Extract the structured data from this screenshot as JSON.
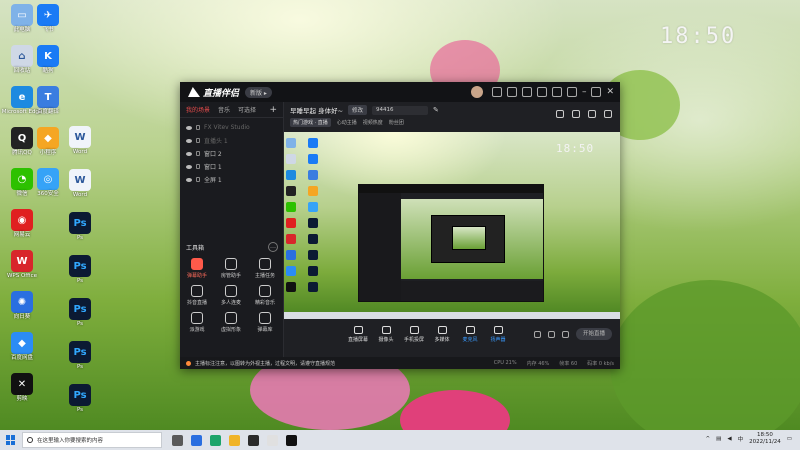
{
  "desktop": {
    "clock": "18:50",
    "icons_left": [
      {
        "label": "此电脑",
        "color": "#7fb2e8",
        "glyph": "▭"
      },
      {
        "label": "回收站",
        "color": "#cfd8e6",
        "glyph": "⌂"
      },
      {
        "label": "Microsoft Edge",
        "color": "#1d8ae0",
        "glyph": "e"
      },
      {
        "label": "腾讯QQ",
        "color": "#222222",
        "glyph": "Q"
      },
      {
        "label": "微信",
        "color": "#2dc100",
        "glyph": "◔"
      },
      {
        "label": "网易云",
        "color": "#e02020",
        "glyph": "◉"
      },
      {
        "label": "WPS Office",
        "color": "#d8262b",
        "glyph": "W"
      },
      {
        "label": "向日葵",
        "color": "#2a6fe0",
        "glyph": "✺"
      },
      {
        "label": "百度网盘",
        "color": "#2b8cf5",
        "glyph": "◆"
      },
      {
        "label": "剪映",
        "color": "#111111",
        "glyph": "✕"
      }
    ],
    "icons_col2": [
      {
        "label": "飞书",
        "color": "#1a7bf5",
        "glyph": "✈"
      },
      {
        "label": "酷狗",
        "color": "#1a7bf5",
        "glyph": "K"
      },
      {
        "label": "百度翻译",
        "color": "#3a7de0",
        "glyph": "T"
      },
      {
        "label": "小程序",
        "color": "#f5a623",
        "glyph": "◆"
      },
      {
        "label": "360安全",
        "color": "#36a3f7",
        "glyph": "◎"
      }
    ],
    "icons_col3": [
      {
        "label": "Word",
        "color": "#f0f4fa",
        "glyph": "W"
      },
      {
        "label": "Word",
        "color": "#f0f4fa",
        "glyph": "W"
      },
      {
        "label": "Ps",
        "color": "#0b1a33",
        "glyph": "Ps"
      },
      {
        "label": "Ps",
        "color": "#0b1a33",
        "glyph": "Ps"
      },
      {
        "label": "Ps",
        "color": "#0b1a33",
        "glyph": "Ps"
      },
      {
        "label": "Ps",
        "color": "#0b1a33",
        "glyph": "Ps"
      },
      {
        "label": "Ps",
        "color": "#0b1a33",
        "glyph": "Ps"
      }
    ]
  },
  "app": {
    "logo_text": "直播伴侣",
    "version_label": "新版 ▸",
    "left_tabs": [
      "我的场景",
      "音乐",
      "可选择"
    ],
    "scene_items": [
      {
        "label": "FX Vitev Studio",
        "dim": true
      },
      {
        "label": "直播头 1",
        "dim": true
      },
      {
        "label": "窗口 2",
        "dim": false
      },
      {
        "label": "窗口 1",
        "dim": false
      },
      {
        "label": "全屏 1",
        "dim": false
      }
    ],
    "tools_title": "工具箱",
    "tools": [
      {
        "label": "弹幕助手",
        "red": true
      },
      {
        "label": "房管助手",
        "red": false
      },
      {
        "label": "主播任务",
        "red": false
      },
      {
        "label": "抖音直播",
        "red": false
      },
      {
        "label": "多人连麦",
        "red": false
      },
      {
        "label": "精彩音乐",
        "red": false
      },
      {
        "label": "派游戏",
        "red": false
      },
      {
        "label": "虚拟形象",
        "red": false
      },
      {
        "label": "弹幕库",
        "red": false
      }
    ],
    "stream_title": "早睡早起 身体好~",
    "edit_badge": "修改",
    "room_id": "94416",
    "meta_tag": "热门游戏 · 直播",
    "meta_items": [
      "心动主播",
      "视频热度",
      "粉丝团"
    ],
    "toolbar": [
      {
        "label": "直播屏幕",
        "blue": false
      },
      {
        "label": "摄像头",
        "blue": false
      },
      {
        "label": "手机投屏",
        "blue": false
      },
      {
        "label": "多媒体",
        "blue": false
      },
      {
        "label": "麦克风",
        "blue": true
      },
      {
        "label": "扬声器",
        "blue": true
      }
    ],
    "go_live": "开始直播",
    "status_text": "主播标注注意，以图转为外视主播，过程文明，请遵守直播规范",
    "status_stats": [
      "CPU 21%",
      "内存 46%",
      "帧率 60",
      "码率 0 kb/s"
    ]
  },
  "taskbar": {
    "search_placeholder": "在这里输入你要搜索的内容",
    "time": "18:50",
    "date": "2022/11/24",
    "lang": "中",
    "app_colors": [
      "#5a5a5a",
      "#2b6fe0",
      "#1da46a",
      "#f0b428",
      "#2b2b2b",
      "#e0e0e0",
      "#111111"
    ]
  }
}
